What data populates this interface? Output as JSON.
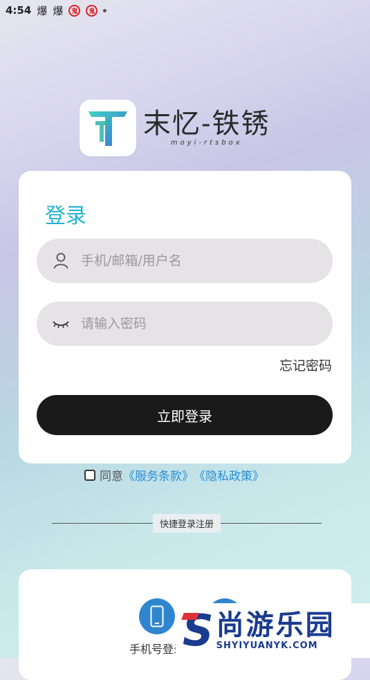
{
  "status_bar": {
    "time": "4:54",
    "icon1": "爆",
    "icon2": "爆",
    "icon3": "鬼",
    "icon4": "鬼"
  },
  "brand": {
    "name": "末忆-铁锈",
    "subtitle": "moyi-rtsbox",
    "logo_icon": "T-logo-icon"
  },
  "login": {
    "title": "登录",
    "account_placeholder": "手机/邮箱/用户名",
    "password_placeholder": "请输入密码",
    "forgot_label": "忘记密码",
    "submit_label": "立即登录"
  },
  "agreement": {
    "prefix": "同意",
    "terms": "《服务条款》",
    "privacy": "《隐私政策》",
    "checked": false
  },
  "quick": {
    "divider_label": "快捷登录注册",
    "phone_label": "手机号登录"
  },
  "watermark": {
    "letter": "S",
    "cn": "尚游乐园",
    "en": "SHYIYUANYK.COM"
  },
  "colors": {
    "accent": "#22b3cf",
    "link": "#2a8fd6",
    "button": "#1a1a1a",
    "watermark": "#1a3b8f"
  }
}
